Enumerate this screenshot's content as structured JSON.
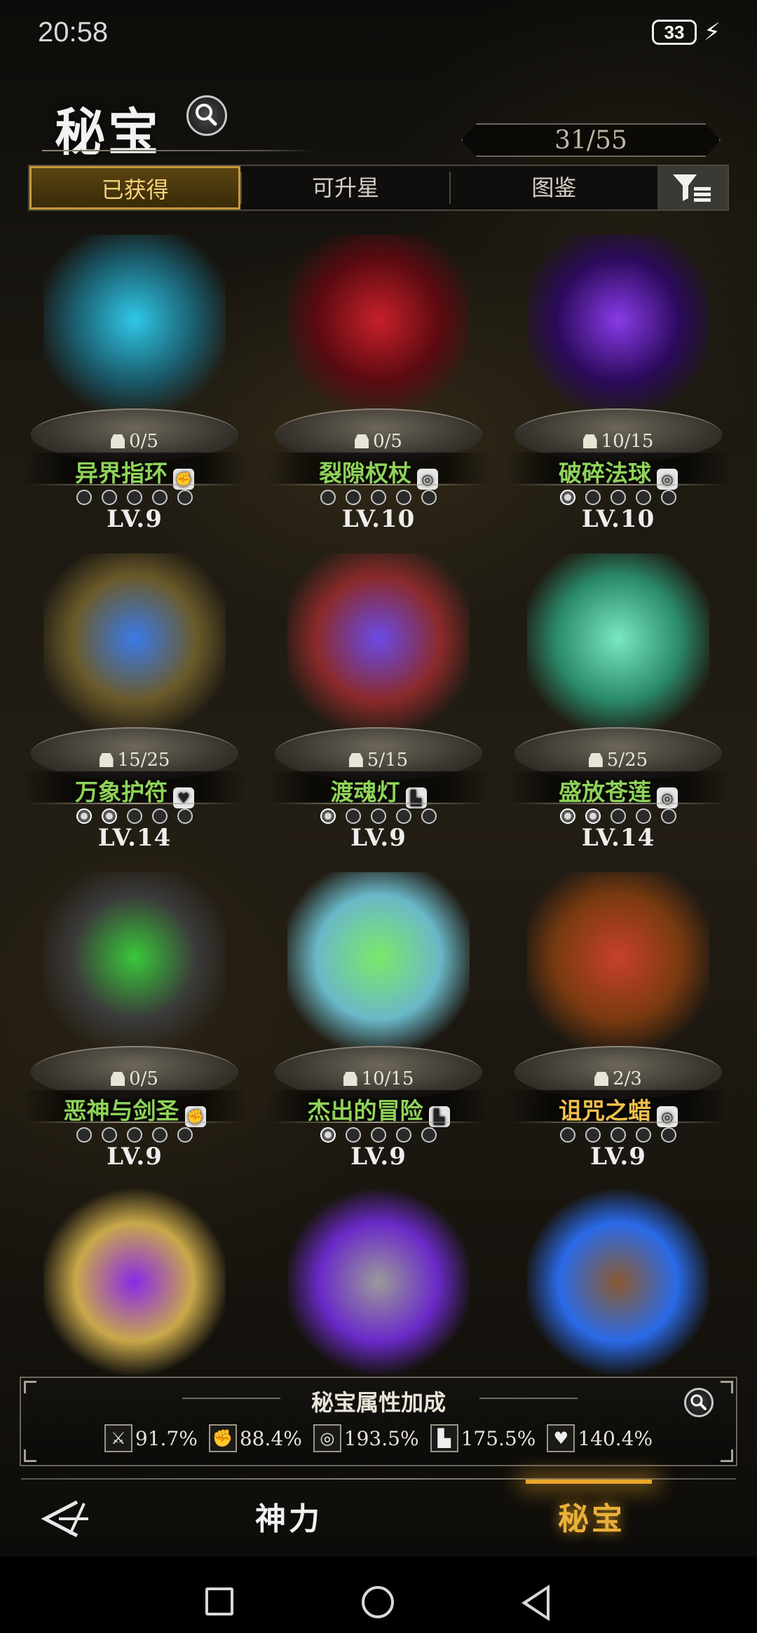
{
  "status": {
    "time": "20:58",
    "battery": "33"
  },
  "header": {
    "title": "秘宝",
    "counter": "31/55"
  },
  "tabs": [
    {
      "label": "已获得",
      "active": true
    },
    {
      "label": "可升星",
      "active": false
    },
    {
      "label": "图鉴",
      "active": false
    }
  ],
  "treasures": [
    {
      "name": "异界指环",
      "fragments": "0/5",
      "level": "LV.9",
      "stars_lit": 0,
      "rarity": "green",
      "type_icon": "fist-icon",
      "art_colors": [
        "#2fc8e8",
        "#1a5a6a"
      ]
    },
    {
      "name": "裂隙权杖",
      "fragments": "0/5",
      "level": "LV.10",
      "stars_lit": 0,
      "rarity": "green",
      "type_icon": "vortex-icon",
      "art_colors": [
        "#c8202a",
        "#5a0a10"
      ]
    },
    {
      "name": "破碎法球",
      "fragments": "10/15",
      "level": "LV.10",
      "stars_lit": 1,
      "rarity": "green",
      "type_icon": "vortex-icon",
      "art_colors": [
        "#8a3ae8",
        "#2a0a5a"
      ]
    },
    {
      "name": "万象护符",
      "fragments": "15/25",
      "level": "LV.14",
      "stars_lit": 2,
      "rarity": "green",
      "type_icon": "heart-icon",
      "art_colors": [
        "#3a7ae8",
        "#6a5a2a"
      ]
    },
    {
      "name": "渡魂灯",
      "fragments": "5/15",
      "level": "LV.9",
      "stars_lit": 1,
      "rarity": "green",
      "type_icon": "boot-icon",
      "art_colors": [
        "#6a4ae8",
        "#8a2a2a"
      ]
    },
    {
      "name": "盛放苍莲",
      "fragments": "5/25",
      "level": "LV.14",
      "stars_lit": 2,
      "rarity": "green",
      "type_icon": "vortex-icon",
      "art_colors": [
        "#7ae8c0",
        "#2a8a6a"
      ]
    },
    {
      "name": "恶神与剑圣",
      "fragments": "0/5",
      "level": "LV.9",
      "stars_lit": 0,
      "rarity": "green",
      "type_icon": "fist-icon",
      "art_colors": [
        "#3ac83a",
        "#3a3a3a"
      ]
    },
    {
      "name": "杰出的冒险",
      "fragments": "10/15",
      "level": "LV.9",
      "stars_lit": 1,
      "rarity": "green",
      "type_icon": "boot-icon",
      "art_colors": [
        "#7ae86a",
        "#6ab8c8"
      ]
    },
    {
      "name": "诅咒之蜡",
      "fragments": "2/3",
      "level": "LV.9",
      "stars_lit": 0,
      "rarity": "gold",
      "type_icon": "vortex-icon",
      "art_colors": [
        "#c8402a",
        "#7a3a10"
      ]
    }
  ],
  "partial_row": [
    {
      "art_colors": [
        "#8a2ae8",
        "#c8a84a"
      ]
    },
    {
      "art_colors": [
        "#9a9a9a",
        "#6a2ac8"
      ]
    },
    {
      "art_colors": [
        "#8a5a30",
        "#2a6ae8"
      ]
    }
  ],
  "bonus": {
    "title": "秘宝属性加成",
    "stats": [
      {
        "icon": "sword-icon",
        "value": "91.7%"
      },
      {
        "icon": "fist-icon",
        "value": "88.4%"
      },
      {
        "icon": "vortex-icon",
        "value": "193.5%"
      },
      {
        "icon": "boot-icon",
        "value": "175.5%"
      },
      {
        "icon": "heart-icon",
        "value": "140.4%"
      }
    ]
  },
  "nav": {
    "item1": "神力",
    "item2": "秘宝",
    "active": "秘宝"
  }
}
